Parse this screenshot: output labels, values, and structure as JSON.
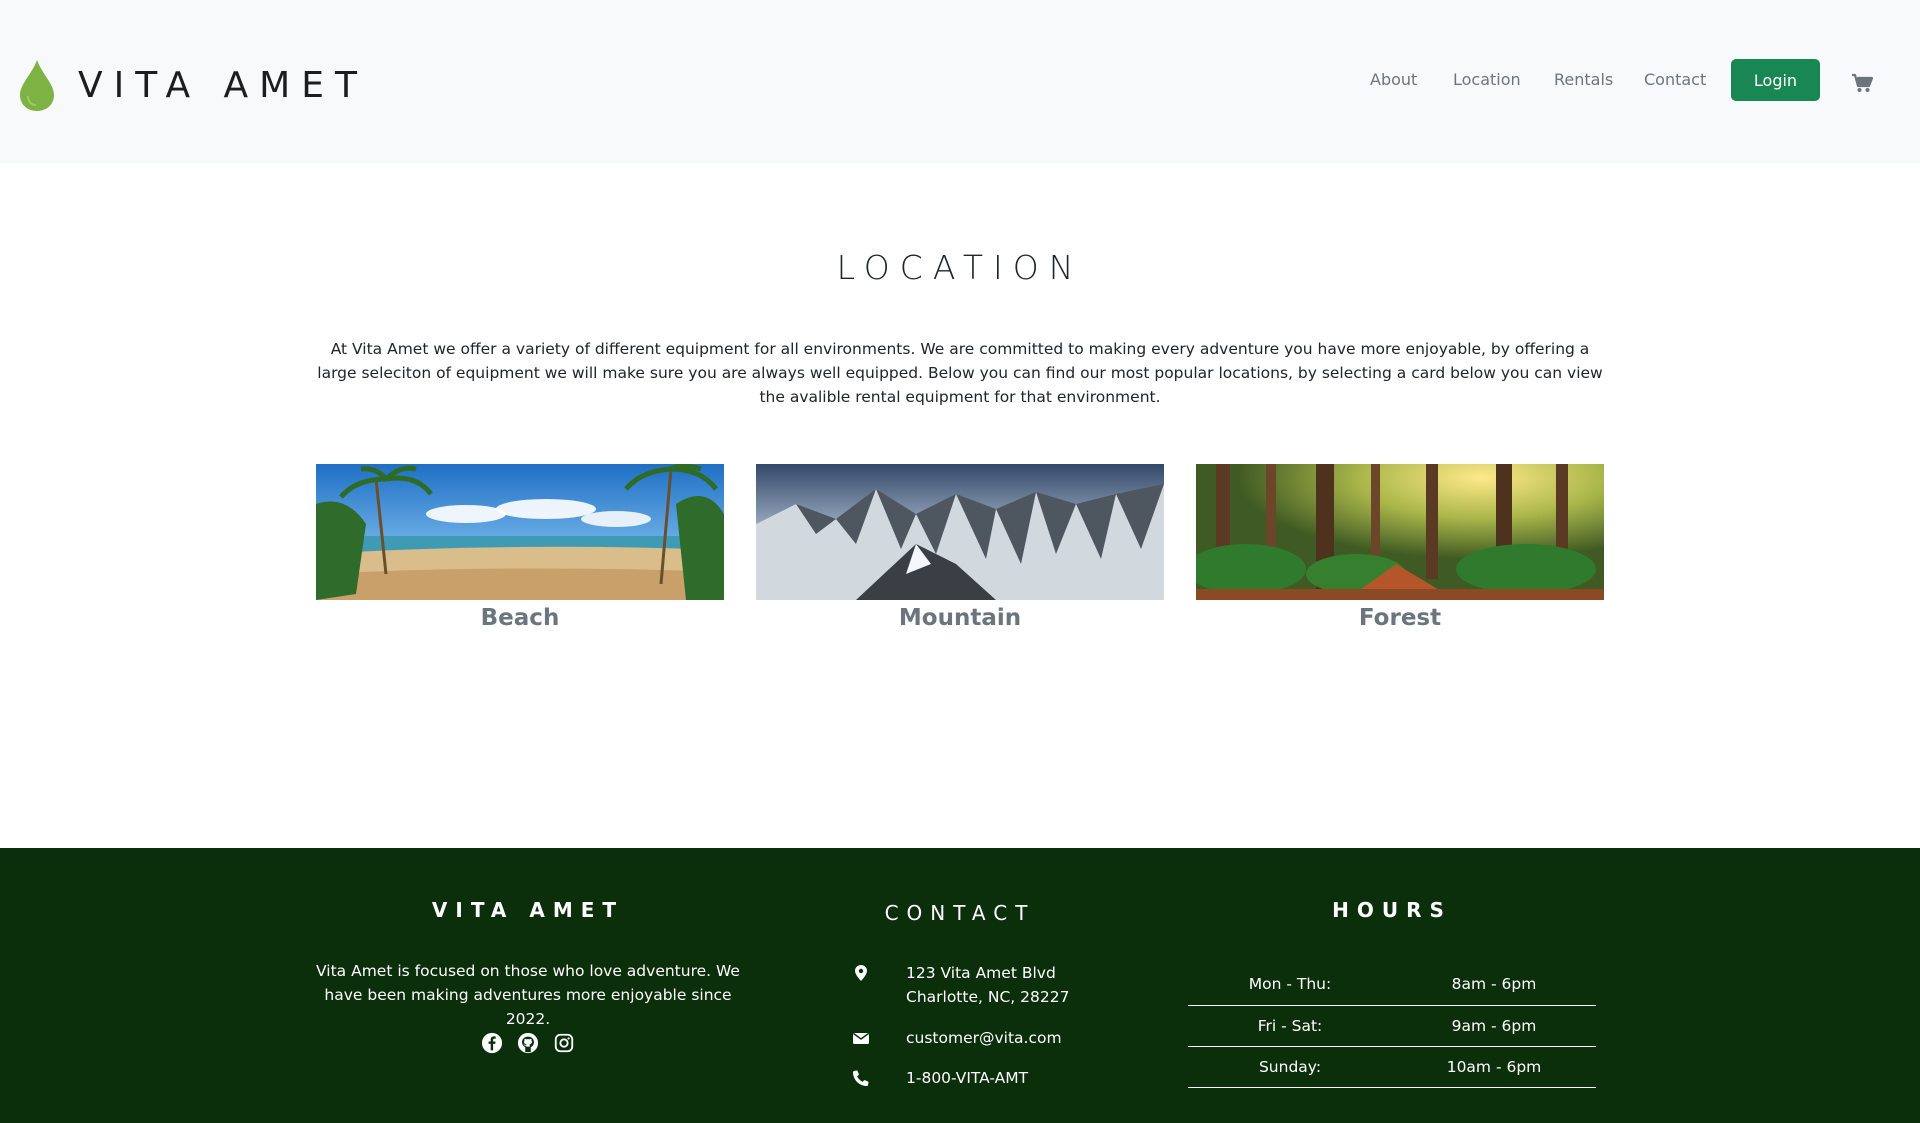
{
  "brand": {
    "name": "VITA AMET",
    "logo_icon": "drop-icon",
    "logo_color": "#7cb342"
  },
  "nav": {
    "links": [
      "About",
      "Location",
      "Rentals",
      "Contact"
    ],
    "login_label": "Login",
    "cart_icon": "cart-icon"
  },
  "main": {
    "title": "LOCATION",
    "intro": "At Vita Amet we offer a variety of different equipment for all environments. We are committed to making every adventure you have more enjoyable, by offering a large seleciton of equipment we will make sure you are always well equipped. Below you can find our most popular locations, by selecting a card below you can view the avalible rental equipment for that environment.",
    "cards": [
      {
        "label": "Beach"
      },
      {
        "label": "Mountain"
      },
      {
        "label": "Forest"
      }
    ]
  },
  "footer": {
    "about": {
      "title": "VITA AMET",
      "text": "Vita Amet is focused on those who love adventure. We have been making adventures more enjoyable since 2022.",
      "socials": [
        "facebook-icon",
        "github-icon",
        "instagram-icon"
      ]
    },
    "contact": {
      "title": "CONTACT",
      "address_line1": "123 Vita Amet Blvd",
      "address_line2": "Charlotte, NC, 28227",
      "email": "customer@vita.com",
      "phone": "1-800-VITA-AMT"
    },
    "hours": {
      "title": "HOURS",
      "rows": [
        {
          "days": "Mon - Thu:",
          "time": "8am - 6pm"
        },
        {
          "days": "Fri - Sat:",
          "time": "9am - 6pm"
        },
        {
          "days": "Sunday:",
          "time": "10am - 6pm"
        }
      ]
    }
  },
  "colors": {
    "accent": "#198754",
    "footer_bg": "#0b2e0b",
    "header_bg": "#f8f9fa"
  }
}
